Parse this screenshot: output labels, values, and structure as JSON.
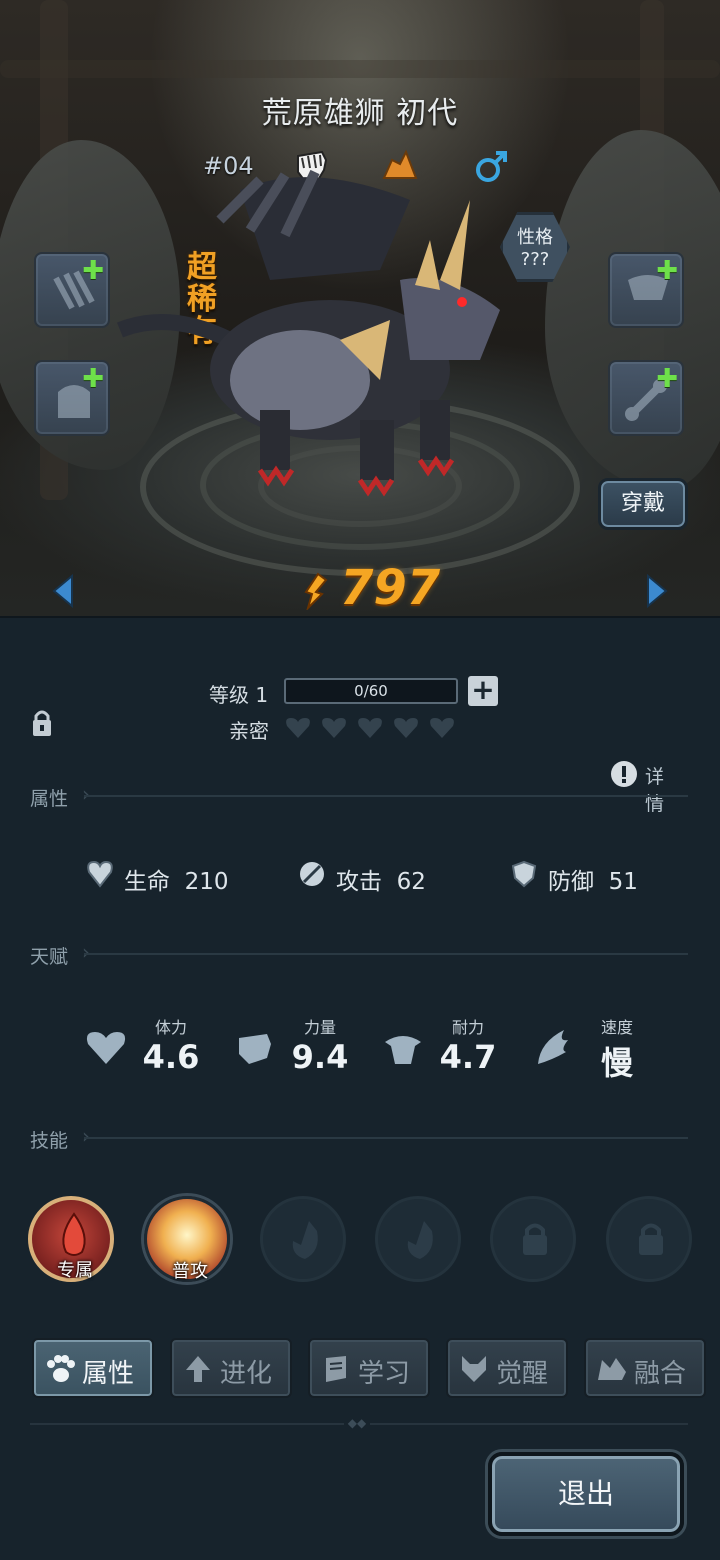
{
  "pet": {
    "name": "荒原雄狮 初代",
    "number": "#04",
    "rarity": "超稀有",
    "trait_label": "性格",
    "trait_value": "???",
    "power": "797"
  },
  "scene": {
    "wear_button": "穿戴"
  },
  "level": {
    "label": "等级 1",
    "xp": "0/60",
    "affinity_label": "亲密"
  },
  "detail_label": "详情",
  "sections": {
    "attributes": "属性",
    "talents": "天赋",
    "skills": "技能"
  },
  "attributes": [
    {
      "label": "生命",
      "value": "210"
    },
    {
      "label": "攻击",
      "value": "62"
    },
    {
      "label": "防御",
      "value": "51"
    }
  ],
  "talents": [
    {
      "name": "体力",
      "value": "4.6"
    },
    {
      "name": "力量",
      "value": "9.4"
    },
    {
      "name": "耐力",
      "value": "4.7"
    },
    {
      "name": "速度",
      "value": "慢"
    }
  ],
  "skills": [
    {
      "label": "专属"
    },
    {
      "label": "普攻"
    }
  ],
  "tabs": [
    {
      "label": "属性"
    },
    {
      "label": "进化"
    },
    {
      "label": "学习"
    },
    {
      "label": "觉醒"
    },
    {
      "label": "融合"
    }
  ],
  "exit_button": "退出",
  "colors": {
    "rarity": "#f0a024",
    "power": "#f5a623",
    "equip_plus": "#6ee04a",
    "male": "#3aa6e0"
  }
}
